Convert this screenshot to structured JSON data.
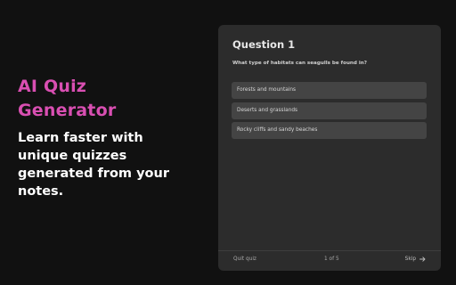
{
  "hero": {
    "title": "AI Quiz Generator",
    "subtitle": "Learn faster with unique quizzes generated from your notes."
  },
  "quiz": {
    "heading": "Question 1",
    "question": "What type of habitats can seagulls be found in?",
    "options": [
      {
        "label": "Forests and mountains"
      },
      {
        "label": "Deserts and grasslands"
      },
      {
        "label": "Rocky cliffs and sandy beaches"
      }
    ],
    "footer": {
      "quit_label": "Quit quiz",
      "progress": "1 of 5",
      "skip_label": "Skip",
      "skip_icon": "arrow-right-icon"
    }
  },
  "colors": {
    "background": "#111111",
    "accent": "#d94fb2",
    "card": "#2c2c2c",
    "option": "#444444"
  }
}
